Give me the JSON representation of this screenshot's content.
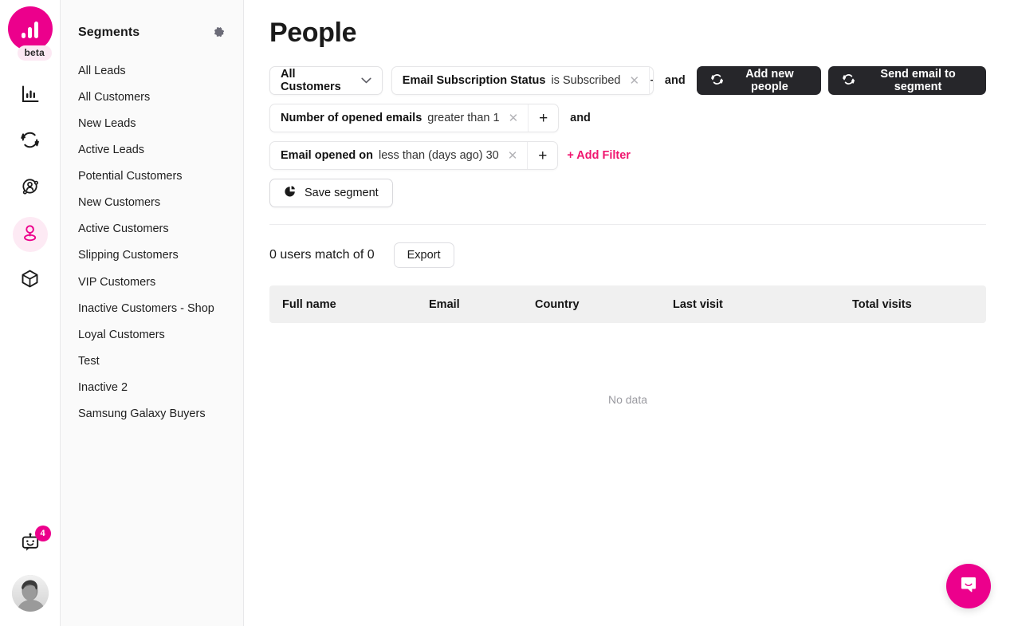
{
  "rail": {
    "logo": {
      "name": "analytics-logo",
      "badge": "beta"
    },
    "items": [
      {
        "icon": "bar-chart-icon",
        "name": "rail-item-analytics",
        "active": false
      },
      {
        "icon": "sync-icon",
        "name": "rail-item-automation",
        "active": false
      },
      {
        "icon": "user-network-icon",
        "name": "rail-item-audience",
        "active": false
      },
      {
        "icon": "person-pin-icon",
        "name": "rail-item-people",
        "active": true
      },
      {
        "icon": "cube-icon",
        "name": "rail-item-products",
        "active": false
      }
    ],
    "bot": {
      "icon": "chat-bot-icon",
      "badge": "4"
    },
    "avatar": {
      "name": "user-avatar"
    }
  },
  "segments": {
    "title": "Segments",
    "settings_icon": "gear-icon",
    "items": [
      {
        "label": "All Leads"
      },
      {
        "label": "All Customers"
      },
      {
        "label": "New Leads"
      },
      {
        "label": "Active Leads"
      },
      {
        "label": "Potential Customers"
      },
      {
        "label": "New Customers"
      },
      {
        "label": "Active Customers"
      },
      {
        "label": "Slipping Customers"
      },
      {
        "label": "VIP Customers"
      },
      {
        "label": "Inactive Customers - Shop"
      },
      {
        "label": "Loyal Customers"
      },
      {
        "label": "Test"
      },
      {
        "label": "Inactive 2"
      },
      {
        "label": "Samsung Galaxy Buyers"
      }
    ]
  },
  "page": {
    "title": "People"
  },
  "segment_select": {
    "value": "All Customers",
    "chevron_icon": "chevron-down-icon"
  },
  "filters": [
    {
      "field": "Email Subscription Status",
      "rest": "is Subscribed",
      "remove_icon": "close-icon",
      "add_icon": "plus-icon",
      "conjunction": "and"
    },
    {
      "field": "Number of opened emails",
      "rest": "greater than 1",
      "remove_icon": "close-icon",
      "add_icon": "plus-icon",
      "conjunction": "and"
    },
    {
      "field": "Email opened on",
      "rest": "less than (days ago) 30",
      "remove_icon": "close-icon",
      "add_icon": "plus-icon",
      "conjunction": ""
    }
  ],
  "add_filter_label": "+ Add Filter",
  "actions": {
    "add_people_label": "Add new people",
    "add_people_icon": "refresh-icon",
    "send_email_label": "Send email to segment",
    "send_email_icon": "refresh-icon",
    "save_segment_label": "Save segment",
    "save_segment_icon": "pie-chart-icon"
  },
  "results": {
    "match_text": "0 users match of 0",
    "export_label": "Export"
  },
  "table": {
    "columns": [
      "Full name",
      "Email",
      "Country",
      "Last visit",
      "Total visits"
    ],
    "rows": [],
    "empty_text": "No data"
  },
  "intercom": {
    "icon": "intercom-chat-icon"
  },
  "colors": {
    "brand_pink": "#ec008c",
    "accent_pink": "#f0156f",
    "dark_button": "#26262a",
    "table_header_bg": "#f0f0f0",
    "panel_bg": "#fafafa"
  }
}
